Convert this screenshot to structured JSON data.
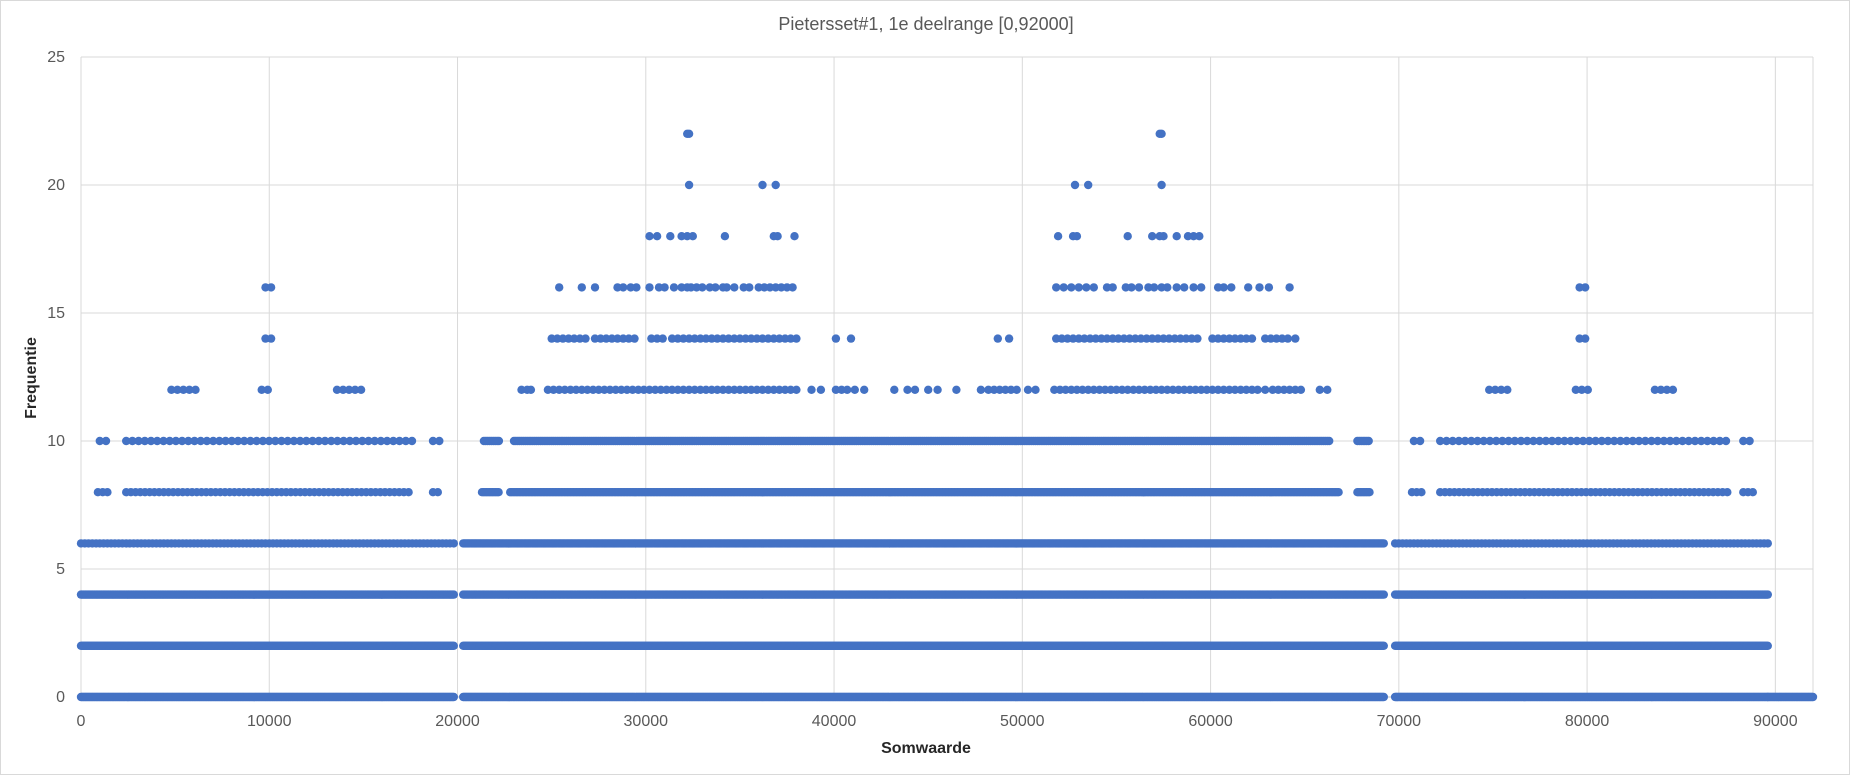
{
  "chart_data": {
    "type": "scatter",
    "title": "Pietersset#1, 1e deelrange [0,92000]",
    "xlabel": "Somwaarde",
    "ylabel": "Frequentie",
    "xlim": [
      0,
      92000
    ],
    "ylim": [
      0,
      25
    ],
    "x_ticks": [
      "0",
      "10000",
      "20000",
      "30000",
      "40000",
      "50000",
      "60000",
      "70000",
      "80000",
      "90000"
    ],
    "y_ticks": [
      "0",
      "5",
      "10",
      "15",
      "20",
      "25"
    ],
    "grid": true,
    "legend": "none",
    "marker_color": "#4472c4",
    "bands": [
      {
        "x": [
          0,
          19800
        ],
        "levels": [
          {
            "y": 0,
            "step": 50
          },
          {
            "y": 2,
            "step": 50
          },
          {
            "y": 4,
            "step": 50
          },
          {
            "y": 6,
            "step": 200
          },
          {
            "y": 8,
            "step": 250,
            "ranges": [
              [
                900,
                1500
              ],
              [
                2400,
                17600
              ],
              [
                18700,
                19100
              ]
            ]
          },
          {
            "y": 10,
            "step": 330,
            "ranges": [
              [
                1000,
                1500
              ],
              [
                2400,
                17600
              ],
              [
                18700,
                19100
              ]
            ]
          },
          {
            "y": 12,
            "step": 320,
            "ranges": [
              [
                4800,
                6300
              ],
              [
                9600,
                10200
              ],
              [
                13600,
                15000
              ]
            ]
          },
          {
            "y": 14,
            "step": 300,
            "ranges": [
              [
                9800,
                10100
              ]
            ]
          },
          {
            "y": 16,
            "step": 300,
            "ranges": [
              [
                9800,
                10100
              ]
            ]
          }
        ]
      },
      {
        "x": [
          20300,
          69200
        ],
        "levels": [
          {
            "y": 0,
            "step": 50
          },
          {
            "y": 2,
            "step": 50
          },
          {
            "y": 4,
            "step": 60
          },
          {
            "y": 6,
            "step": 60
          },
          {
            "y": 8,
            "step": 80,
            "ranges": [
              [
                21300,
                22200
              ],
              [
                22800,
                66800
              ],
              [
                67800,
                68500
              ]
            ]
          },
          {
            "y": 10,
            "step": 100,
            "ranges": [
              [
                21400,
                22200
              ],
              [
                23000,
                66300
              ],
              [
                67800,
                68400
              ]
            ]
          }
        ]
      },
      {
        "x": [
          69800,
          89600
        ],
        "levels": [
          {
            "y": 0,
            "step": 50
          },
          {
            "y": 2,
            "step": 50
          },
          {
            "y": 4,
            "step": 50
          },
          {
            "y": 6,
            "step": 200
          },
          {
            "y": 8,
            "step": 250,
            "ranges": [
              [
                70700,
                71200
              ],
              [
                72200,
                87500
              ],
              [
                88300,
                88800
              ]
            ]
          },
          {
            "y": 10,
            "step": 330,
            "ranges": [
              [
                70800,
                71300
              ],
              [
                72200,
                87500
              ],
              [
                88300,
                88800
              ]
            ]
          },
          {
            "y": 12,
            "step": 320,
            "ranges": [
              [
                74800,
                76000
              ],
              [
                79400,
                80100
              ],
              [
                83600,
                84800
              ]
            ]
          },
          {
            "y": 14,
            "step": 300,
            "ranges": [
              [
                79600,
                80000
              ]
            ]
          },
          {
            "y": 16,
            "step": 300,
            "ranges": [
              [
                79600,
                80000
              ]
            ]
          }
        ]
      },
      {
        "x": [
          89600,
          92000
        ],
        "levels": [
          {
            "y": 0,
            "step": 50
          }
        ]
      }
    ],
    "points": [
      {
        "y": 12,
        "x": [
          23400,
          23700,
          23900,
          24800,
          25100,
          25400,
          25700,
          26000,
          26300,
          26600,
          26900,
          27200,
          27500,
          27800,
          28100,
          28400,
          28700,
          29000,
          29300,
          29600,
          29900,
          30200,
          30500,
          30800,
          31100,
          31400,
          31700,
          32000,
          32300,
          32600,
          32900,
          33200,
          33500,
          33800,
          34100,
          34400,
          34700,
          35000,
          35300,
          35600,
          35900,
          36200,
          36500,
          36800,
          37100,
          37400,
          37700,
          38000,
          38800,
          39300,
          40100,
          40400,
          40700,
          41100,
          41600,
          43200,
          43900,
          44300,
          45000,
          45500,
          46500,
          47800,
          48200,
          48500,
          48800,
          49100,
          49400,
          49700,
          50300,
          50700,
          51700,
          52000,
          52300,
          52600,
          52900,
          53200,
          53500,
          53800,
          54100,
          54400,
          54700,
          55000,
          55300,
          55600,
          55900,
          56200,
          56500,
          56800,
          57100,
          57400,
          57700,
          58000,
          58300,
          58600,
          58900,
          59200,
          59500,
          59800,
          60100,
          60400,
          60700,
          61000,
          61300,
          61600,
          61900,
          62200,
          62500,
          62900,
          63300,
          63600,
          63900,
          64200,
          64500,
          64800,
          65800,
          66200
        ]
      },
      {
        "y": 14,
        "x": [
          25000,
          25300,
          25600,
          25900,
          26200,
          26500,
          26800,
          27300,
          27600,
          27900,
          28200,
          28500,
          28800,
          29100,
          29400,
          30300,
          30600,
          30900,
          31400,
          31700,
          32000,
          32300,
          32600,
          32900,
          33200,
          33500,
          33800,
          34100,
          34400,
          34700,
          35000,
          35300,
          35600,
          35900,
          36200,
          36500,
          36800,
          37100,
          37400,
          37700,
          38000,
          40100,
          40900,
          48700,
          49300,
          51800,
          52100,
          52400,
          52700,
          53000,
          53300,
          53600,
          53900,
          54200,
          54500,
          54800,
          55100,
          55400,
          55700,
          56000,
          56300,
          56600,
          56900,
          57200,
          57500,
          57800,
          58100,
          58400,
          58700,
          59000,
          59300,
          60100,
          60400,
          60700,
          61000,
          61300,
          61600,
          61900,
          62200,
          62900,
          63200,
          63500,
          63800,
          64100,
          64500
        ]
      },
      {
        "y": 16,
        "x": [
          25400,
          26600,
          27300,
          28500,
          28800,
          29200,
          29500,
          30200,
          30700,
          31000,
          31500,
          31900,
          32200,
          32400,
          32700,
          33000,
          33400,
          33700,
          34100,
          34300,
          34700,
          35200,
          35500,
          36000,
          36300,
          36600,
          36900,
          37200,
          37500,
          37800,
          51800,
          52200,
          52600,
          53000,
          53400,
          53800,
          54500,
          54800,
          55500,
          55800,
          56200,
          56700,
          57000,
          57400,
          57700,
          58200,
          58600,
          59100,
          59500,
          60400,
          60700,
          61100,
          62000,
          62600,
          63100,
          64200
        ]
      },
      {
        "y": 18,
        "x": [
          30200,
          30600,
          31300,
          31900,
          32200,
          32500,
          34200,
          36800,
          37000,
          37900,
          51900,
          52700,
          52900,
          55600,
          56900,
          57300,
          57500,
          58200,
          58800,
          59100,
          59400
        ]
      },
      {
        "y": 20,
        "x": [
          32300,
          36200,
          36900,
          52800,
          53500,
          57400
        ]
      },
      {
        "y": 22,
        "x": [
          32200,
          32300,
          57300,
          57400
        ]
      }
    ]
  }
}
